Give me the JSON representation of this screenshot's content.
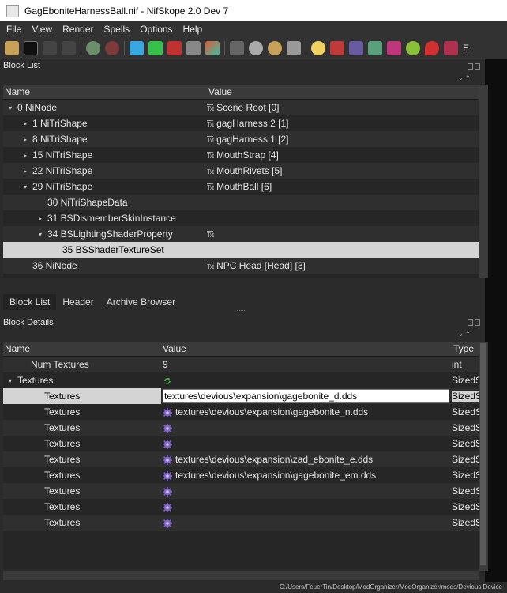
{
  "window": {
    "title": "GagEboniteHarnessBall.nif - NifSkope 2.0 Dev 7"
  },
  "menu": [
    "File",
    "View",
    "Render",
    "Spells",
    "Options",
    "Help"
  ],
  "toolbar_right_text": "E",
  "block_list": {
    "title": "Block List",
    "col_name": "Name",
    "col_value": "Value",
    "rows": [
      {
        "name": "0 NiNode",
        "value": "Scene Root [0]",
        "level": 0,
        "arrow": "▾",
        "txt": true
      },
      {
        "name": "1 NiTriShape",
        "value": "gagHarness:2 [1]",
        "level": 1,
        "arrow": "▸",
        "txt": true
      },
      {
        "name": "8 NiTriShape",
        "value": "gagHarness:1 [2]",
        "level": 1,
        "arrow": "▸",
        "txt": true
      },
      {
        "name": "15 NiTriShape",
        "value": "MouthStrap [4]",
        "level": 1,
        "arrow": "▸",
        "txt": true
      },
      {
        "name": "22 NiTriShape",
        "value": "MouthRivets [5]",
        "level": 1,
        "arrow": "▸",
        "txt": true
      },
      {
        "name": "29 NiTriShape",
        "value": "MouthBall [6]",
        "level": 1,
        "arrow": "▾",
        "txt": true
      },
      {
        "name": "30 NiTriShapeData",
        "value": "",
        "level": 2,
        "arrow": "",
        "txt": false
      },
      {
        "name": "31 BSDismemberSkinInstance",
        "value": "",
        "level": 2,
        "arrow": "▸",
        "txt": false
      },
      {
        "name": "34 BSLightingShaderProperty",
        "value": "",
        "level": 2,
        "arrow": "▾",
        "txt": true
      },
      {
        "name": "35 BSShaderTextureSet",
        "value": "",
        "level": 3,
        "arrow": "",
        "txt": false,
        "selected": true
      },
      {
        "name": "36 NiNode",
        "value": "NPC Head [Head] [3]",
        "level": 1,
        "arrow": "",
        "txt": true
      }
    ]
  },
  "tabs": [
    "Block List",
    "Header",
    "Archive Browser"
  ],
  "block_details": {
    "title": "Block Details",
    "col_name": "Name",
    "col_value": "Value",
    "col_type": "Type",
    "rows": [
      {
        "name": "Num Textures",
        "value": "9",
        "type": "int",
        "level": 1,
        "arrow": "",
        "icon": ""
      },
      {
        "name": "Textures",
        "value": "",
        "type": "SizedS",
        "level": 0,
        "arrow": "▾",
        "icon": "refresh"
      },
      {
        "name": "Textures",
        "value": "textures\\devious\\expansion\\gagebonite_d.dds",
        "type": "SizedS",
        "level": 2,
        "arrow": "",
        "icon": "",
        "selected": true,
        "editing": true
      },
      {
        "name": "Textures",
        "value": "textures\\devious\\expansion\\gagebonite_n.dds",
        "type": "SizedS",
        "level": 2,
        "arrow": "",
        "icon": "gear"
      },
      {
        "name": "Textures",
        "value": "",
        "type": "SizedS",
        "level": 2,
        "arrow": "",
        "icon": "gear"
      },
      {
        "name": "Textures",
        "value": "",
        "type": "SizedS",
        "level": 2,
        "arrow": "",
        "icon": "gear"
      },
      {
        "name": "Textures",
        "value": "textures\\devious\\expansion\\zad_ebonite_e.dds",
        "type": "SizedS",
        "level": 2,
        "arrow": "",
        "icon": "gear"
      },
      {
        "name": "Textures",
        "value": "textures\\devious\\expansion\\gagebonite_em.dds",
        "type": "SizedS",
        "level": 2,
        "arrow": "",
        "icon": "gear"
      },
      {
        "name": "Textures",
        "value": "",
        "type": "SizedS",
        "level": 2,
        "arrow": "",
        "icon": "gear"
      },
      {
        "name": "Textures",
        "value": "",
        "type": "SizedS",
        "level": 2,
        "arrow": "",
        "icon": "gear"
      },
      {
        "name": "Textures",
        "value": "",
        "type": "SizedS",
        "level": 2,
        "arrow": "",
        "icon": "gear"
      }
    ]
  },
  "status_path": "C:/Users/FeuerTin/Desktop/ModOrganizer/ModOrganizer/mods/Devious Device",
  "icons": {
    "toolbar": [
      "open-icon",
      "save-icon",
      "undo-icon",
      "redo-icon",
      "select-icon",
      "nodes-icon",
      "cube-blue-icon",
      "cube-green-icon",
      "cube-red-icon",
      "pin-icon",
      "cube-color-icon",
      "footprint-icon",
      "eye-icon",
      "eye-gold-icon",
      "camera-icon",
      "bulb-icon",
      "wand-icon",
      "axes-icon",
      "graph-icon",
      "color-block-icon",
      "bubble-icon",
      "marker-icon",
      "car-icon"
    ]
  }
}
